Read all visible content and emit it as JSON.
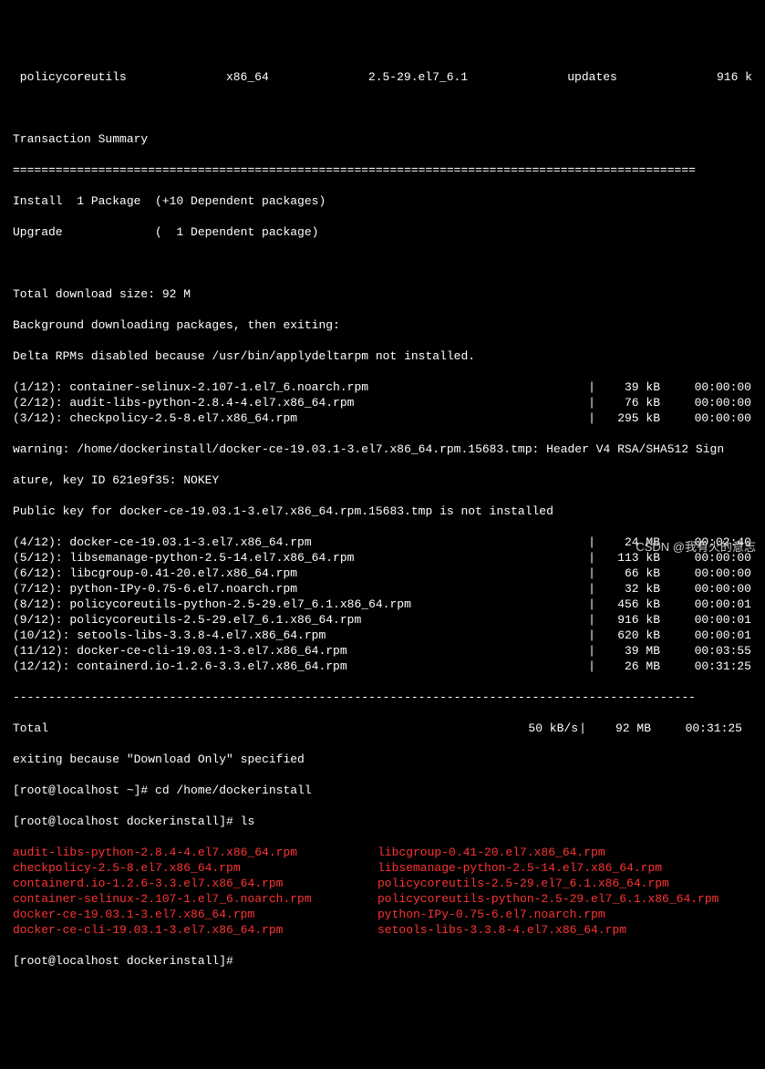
{
  "header": {
    "pkg": " policycoreutils",
    "arch": "x86_64",
    "ver": "2.5-29.el7_6.1",
    "repo": "updates",
    "size": "916 k"
  },
  "summary_title": "Transaction Summary",
  "divider": "================================================================================================",
  "install_line": "Install  1 Package  (+10 Dependent packages)",
  "upgrade_line": "Upgrade             (  1 Dependent package)",
  "total_dl": "Total download size: 92 M",
  "bg_dl": "Background downloading packages, then exiting:",
  "delta": "Delta RPMs disabled because /usr/bin/applydeltarpm not installed.",
  "downloads_a": [
    {
      "n": "(1/12): container-selinux-2.107-1.el7_6.noarch.rpm",
      "s": "39 kB",
      "t": "00:00:00"
    },
    {
      "n": "(2/12): audit-libs-python-2.8.4-4.el7.x86_64.rpm",
      "s": "76 kB",
      "t": "00:00:00"
    },
    {
      "n": "(3/12): checkpolicy-2.5-8.el7.x86_64.rpm",
      "s": "295 kB",
      "t": "00:00:00"
    }
  ],
  "warn1": "warning: /home/dockerinstall/docker-ce-19.03.1-3.el7.x86_64.rpm.15683.tmp: Header V4 RSA/SHA512 Sign",
  "warn2": "ature, key ID 621e9f35: NOKEY",
  "pubkey": "Public key for docker-ce-19.03.1-3.el7.x86_64.rpm.15683.tmp is not installed",
  "downloads_b": [
    {
      "n": "(4/12): docker-ce-19.03.1-3.el7.x86_64.rpm",
      "s": "24 MB",
      "t": "00:02:40"
    },
    {
      "n": "(5/12): libsemanage-python-2.5-14.el7.x86_64.rpm",
      "s": "113 kB",
      "t": "00:00:00"
    },
    {
      "n": "(6/12): libcgroup-0.41-20.el7.x86_64.rpm",
      "s": "66 kB",
      "t": "00:00:00"
    },
    {
      "n": "(7/12): python-IPy-0.75-6.el7.noarch.rpm",
      "s": "32 kB",
      "t": "00:00:00"
    },
    {
      "n": "(8/12): policycoreutils-python-2.5-29.el7_6.1.x86_64.rpm",
      "s": "456 kB",
      "t": "00:00:01"
    },
    {
      "n": "(9/12): policycoreutils-2.5-29.el7_6.1.x86_64.rpm",
      "s": "916 kB",
      "t": "00:00:01"
    },
    {
      "n": "(10/12): setools-libs-3.3.8-4.el7.x86_64.rpm",
      "s": "620 kB",
      "t": "00:00:01"
    },
    {
      "n": "(11/12): docker-ce-cli-19.03.1-3.el7.x86_64.rpm",
      "s": "39 MB",
      "t": "00:03:55"
    },
    {
      "n": "(12/12): containerd.io-1.2.6-3.3.el7.x86_64.rpm",
      "s": "26 MB",
      "t": "00:31:25"
    }
  ],
  "dash": "------------------------------------------------------------------------------------------------",
  "total_row": {
    "n": "Total",
    "rate": "50 kB/s",
    "s": "92 MB",
    "t": "00:31:25"
  },
  "exit_msg": "exiting because \"Download Only\" specified",
  "prompt1": "[root@localhost ~]# cd /home/dockerinstall",
  "prompt2": "[root@localhost dockerinstall]# ls",
  "ls_left": [
    "audit-libs-python-2.8.4-4.el7.x86_64.rpm",
    "checkpolicy-2.5-8.el7.x86_64.rpm",
    "containerd.io-1.2.6-3.3.el7.x86_64.rpm",
    "container-selinux-2.107-1.el7_6.noarch.rpm",
    "docker-ce-19.03.1-3.el7.x86_64.rpm",
    "docker-ce-cli-19.03.1-3.el7.x86_64.rpm"
  ],
  "ls_right": [
    "libcgroup-0.41-20.el7.x86_64.rpm",
    "libsemanage-python-2.5-14.el7.x86_64.rpm",
    "policycoreutils-2.5-29.el7_6.1.x86_64.rpm",
    "policycoreutils-python-2.5-29.el7_6.1.x86_64.rpm",
    "python-IPy-0.75-6.el7.noarch.rpm",
    "setools-libs-3.3.8-4.el7.x86_64.rpm"
  ],
  "prompt3": "[root@localhost dockerinstall]# ",
  "watermark": "CSDN @我有火的意志"
}
